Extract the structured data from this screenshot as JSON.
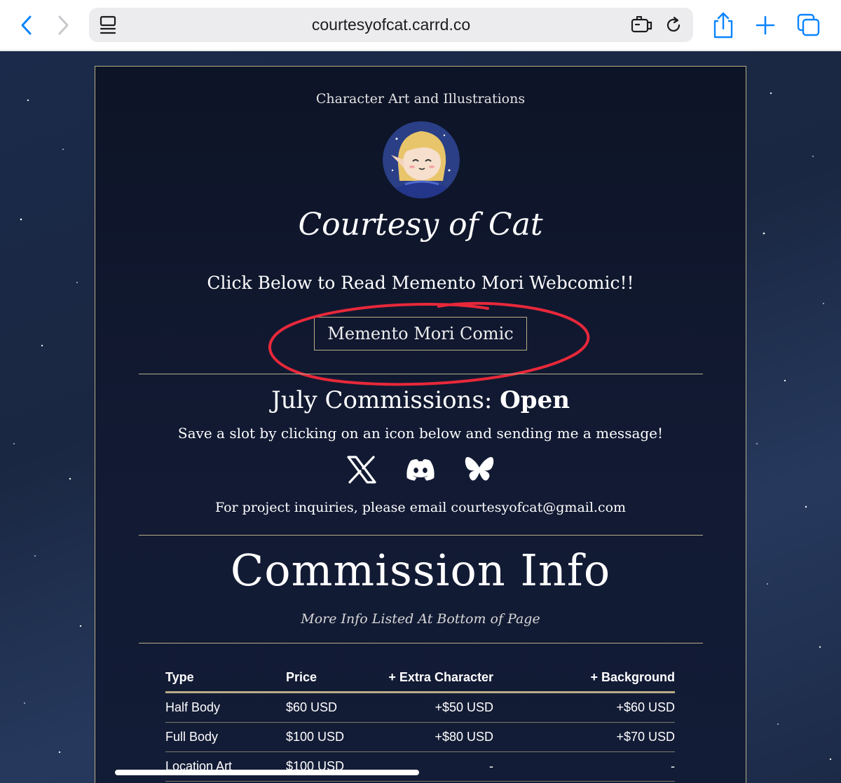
{
  "browser": {
    "url": "courtesyofcat.carrd.co"
  },
  "site": {
    "tagline": "Character Art and Illustrations",
    "title": "Courtesy of Cat",
    "read_heading": "Click Below to Read Memento Mori Webcomic!!",
    "comic_button": "Memento Mori Comic",
    "commissions_label": "July Commissions:",
    "commissions_status": "Open",
    "slot_text": "Save a slot by clicking on an icon below and sending me a message!",
    "social_icons": [
      "x-icon",
      "discord-icon",
      "bluesky-icon"
    ],
    "inquiry_text": "For project inquiries, please email courtesyofcat@gmail.com",
    "commission_info_title": "Commission Info",
    "commission_info_sub": "More Info Listed At Bottom of Page"
  },
  "table": {
    "headers": [
      "Type",
      "Price",
      "+ Extra Character",
      "+ Background"
    ],
    "rows": [
      [
        "Half Body",
        "$60 USD",
        "+$50 USD",
        "+$60 USD"
      ],
      [
        "Full Body",
        "$100 USD",
        "+$80 USD",
        "+$70 USD"
      ],
      [
        "Location Art",
        "$100 USD",
        "-",
        "-"
      ]
    ]
  },
  "colors": {
    "accent_gold": "#b8ad86",
    "annotation_red": "#e8283a",
    "safari_blue": "#0a84ff"
  }
}
